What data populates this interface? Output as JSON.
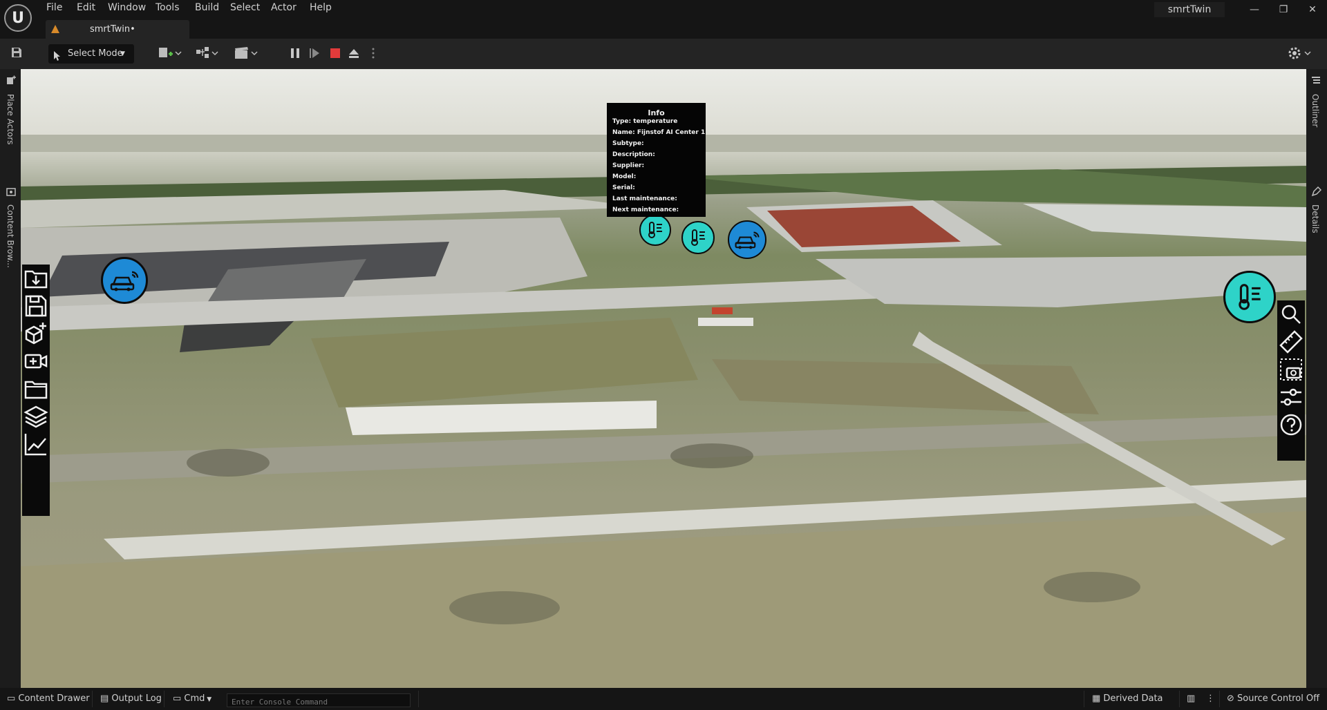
{
  "menu": [
    "File",
    "Edit",
    "Window",
    "Tools",
    "Build",
    "Select",
    "Actor",
    "Help"
  ],
  "window": {
    "project_name": "smrtTwin",
    "minimize": "—",
    "restore": "❐",
    "close": "✕"
  },
  "tab": {
    "label": "smrtTwin•"
  },
  "toolbar": {
    "select_mode": "Select Mode"
  },
  "left_panel": {
    "place_actors": "Place Actors",
    "content_browser": "Content Brow..."
  },
  "right_panel": {
    "outliner": "Outliner",
    "details": "Details"
  },
  "info": {
    "title": "Info",
    "rows": [
      {
        "label": "Type:",
        "value": "temperature"
      },
      {
        "label": "Name:",
        "value": "Fijnstof AI Center 1"
      },
      {
        "label": "Subtype:",
        "value": ""
      },
      {
        "label": "Description:",
        "value": ""
      },
      {
        "label": "Supplier:",
        "value": ""
      },
      {
        "label": "Model:",
        "value": ""
      },
      {
        "label": "Serial:",
        "value": ""
      },
      {
        "label": "Last maintenance:",
        "value": ""
      },
      {
        "label": "Next maintenance:",
        "value": ""
      }
    ]
  },
  "statusbar": {
    "content_drawer": "Content Drawer",
    "output_log": "Output Log",
    "cmd": "Cmd",
    "console_placeholder": "Enter Console Command",
    "derived_data": "Derived Data",
    "source_control": "Source Control Off"
  },
  "colors": {
    "temperature_marker": "#2ed3c8",
    "vehicle_marker": "#1e8ad6",
    "stop_button": "#e23b3b"
  }
}
